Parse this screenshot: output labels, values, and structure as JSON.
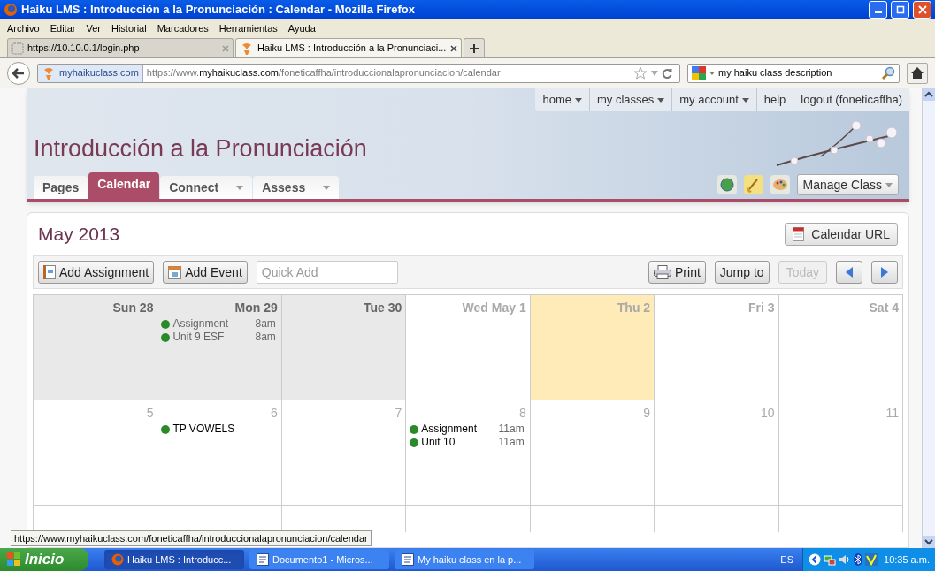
{
  "window": {
    "title": "Haiku LMS : Introducción a la Pronunciación : Calendar - Mozilla Firefox"
  },
  "menu": [
    "Archivo",
    "Editar",
    "Ver",
    "Historial",
    "Marcadores",
    "Herramientas",
    "Ayuda"
  ],
  "browser_tabs": [
    {
      "label": "https://10.10.0.1/login.php",
      "selected": false
    },
    {
      "label": "Haiku LMS : Introducción a la Pronunciaci...",
      "selected": true
    }
  ],
  "address_bar": {
    "site": "myhaikuclass.com",
    "url_prefix": "https://www.",
    "url_domain": "myhaikuclass.com",
    "url_path": "/foneticaffha/introduccionalapronunciacion/calendar"
  },
  "search_bar": {
    "value": "my haiku class description"
  },
  "site_nav": [
    {
      "label": "home",
      "dropdown": true
    },
    {
      "label": "my classes",
      "dropdown": true
    },
    {
      "label": "my account",
      "dropdown": true
    },
    {
      "label": "help",
      "dropdown": false
    },
    {
      "label": "logout (foneticaffha)",
      "dropdown": false
    }
  ],
  "course_title": "Introducción a la Pronunciación",
  "course_tabs": [
    {
      "label": "Pages",
      "selected": false,
      "dropdown": false
    },
    {
      "label": "Calendar",
      "selected": true,
      "dropdown": false
    },
    {
      "label": "Connect",
      "selected": false,
      "dropdown": true
    },
    {
      "label": "Assess",
      "selected": false,
      "dropdown": true
    }
  ],
  "manage_button": "Manage Class",
  "calendar": {
    "month": "May 2013",
    "calendar_url_button": "Calendar URL",
    "toolbar": {
      "add_assignment": "Add Assignment",
      "add_event": "Add Event",
      "quick_add_placeholder": "Quick Add",
      "print": "Print",
      "jump_to": "Jump to",
      "today": {
        "label": "Today",
        "disabled": true
      }
    },
    "weeks": [
      [
        {
          "label": "Sun 28",
          "past": true,
          "today": false
        },
        {
          "label": "Mon 29",
          "past": true,
          "today": false,
          "events": [
            {
              "title": "Assignment",
              "time": "8am"
            },
            {
              "title": "Unit 9 ESF",
              "time": "8am"
            }
          ]
        },
        {
          "label": "Tue 30",
          "past": true,
          "today": false
        },
        {
          "label": "Wed May 1",
          "past": false,
          "today": false
        },
        {
          "label": "Thu 2",
          "past": false,
          "today": true
        },
        {
          "label": "Fri 3",
          "past": false,
          "today": false
        },
        {
          "label": "Sat 4",
          "past": false,
          "today": false
        }
      ],
      [
        {
          "label": "5",
          "past": false,
          "today": false
        },
        {
          "label": "6",
          "past": false,
          "today": false,
          "events": [
            {
              "title": "TP VOWELS"
            }
          ]
        },
        {
          "label": "7",
          "past": false,
          "today": false
        },
        {
          "label": "8",
          "past": false,
          "today": false,
          "events": [
            {
              "title": "Assignment",
              "time": "11am"
            },
            {
              "title": "Unit 10",
              "time": "11am"
            }
          ]
        },
        {
          "label": "9",
          "past": false,
          "today": false
        },
        {
          "label": "10",
          "past": false,
          "today": false
        },
        {
          "label": "11",
          "past": false,
          "today": false
        }
      ]
    ]
  },
  "status_tooltip": "https://www.myhaikuclass.com/foneticaffha/introduccionalapronunciacion/calendar",
  "taskbar": {
    "start": "Inicio",
    "items": [
      {
        "label": "Haiku LMS : Introducc...",
        "selected": true,
        "kind": "firefox"
      },
      {
        "label": "Documento1 - Micros...",
        "selected": false,
        "kind": "document"
      },
      {
        "label": "My haiku class en la p...",
        "selected": false,
        "kind": "document"
      }
    ],
    "language": "ES",
    "clock": "10:35 a.m."
  }
}
